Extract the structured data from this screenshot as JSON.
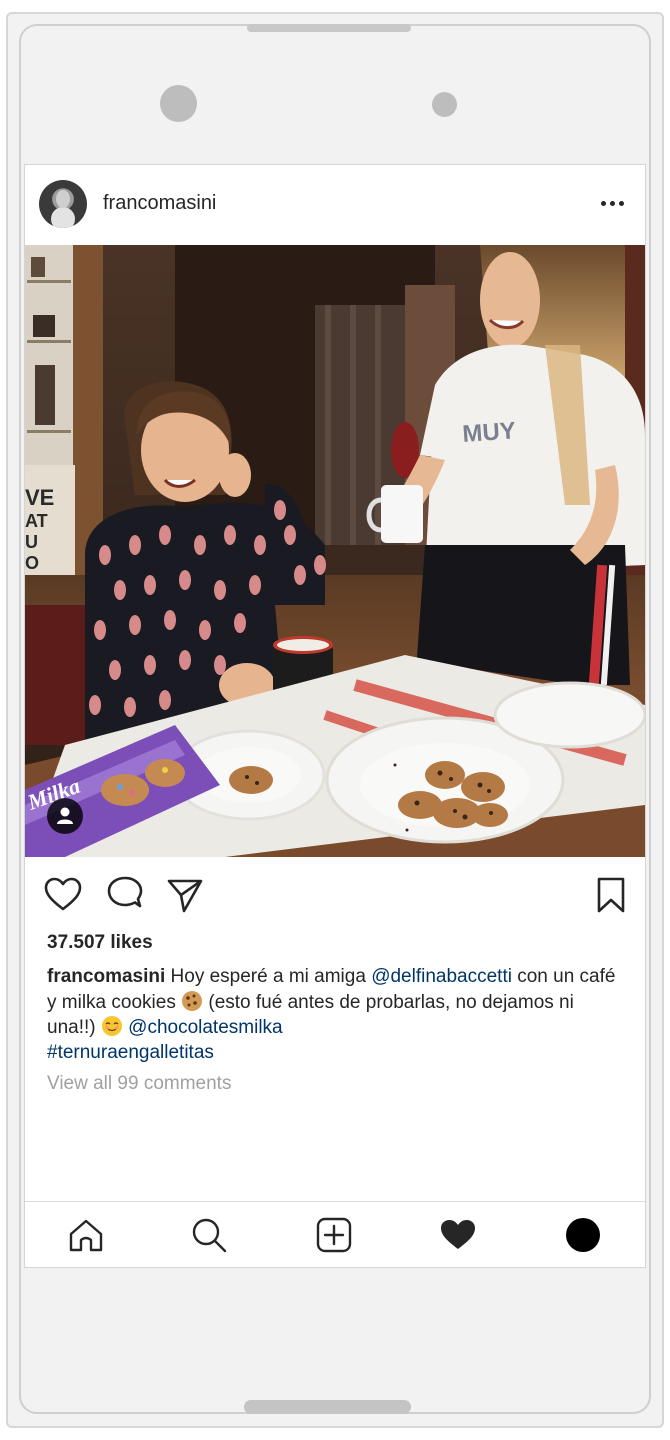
{
  "post": {
    "username": "francomasini",
    "likes": "37.507 likes",
    "caption": {
      "user": "francomasini",
      "text1": " Hoy esperé a mi amiga ",
      "mention1": "@delfinabaccetti",
      "text2": " con un café y milka cookies ",
      "text3": " (esto fué antes de probarlas, no dejamos ni una!!) ",
      "mention2": "@chocolatesmilka",
      "hashtag": "#ternuraengalletitas"
    },
    "view_comments": "View all 99 comments",
    "photo": {
      "shirt_text": "MUY",
      "package_text": "Milka",
      "wall_sign": [
        "VE",
        "AT",
        "U",
        "O"
      ]
    }
  },
  "icons": {
    "more": "more-options-icon",
    "like": "heart-outline-icon",
    "comment": "comment-icon",
    "share": "share-send-icon",
    "save": "bookmark-icon",
    "tagged": "user-tag-icon",
    "nav": [
      "home-icon",
      "search-icon",
      "add-post-icon",
      "activity-heart-icon",
      "profile-icon"
    ]
  },
  "colors": {
    "mention": "#003569",
    "muted": "#a0a0a0",
    "text": "#262626"
  }
}
